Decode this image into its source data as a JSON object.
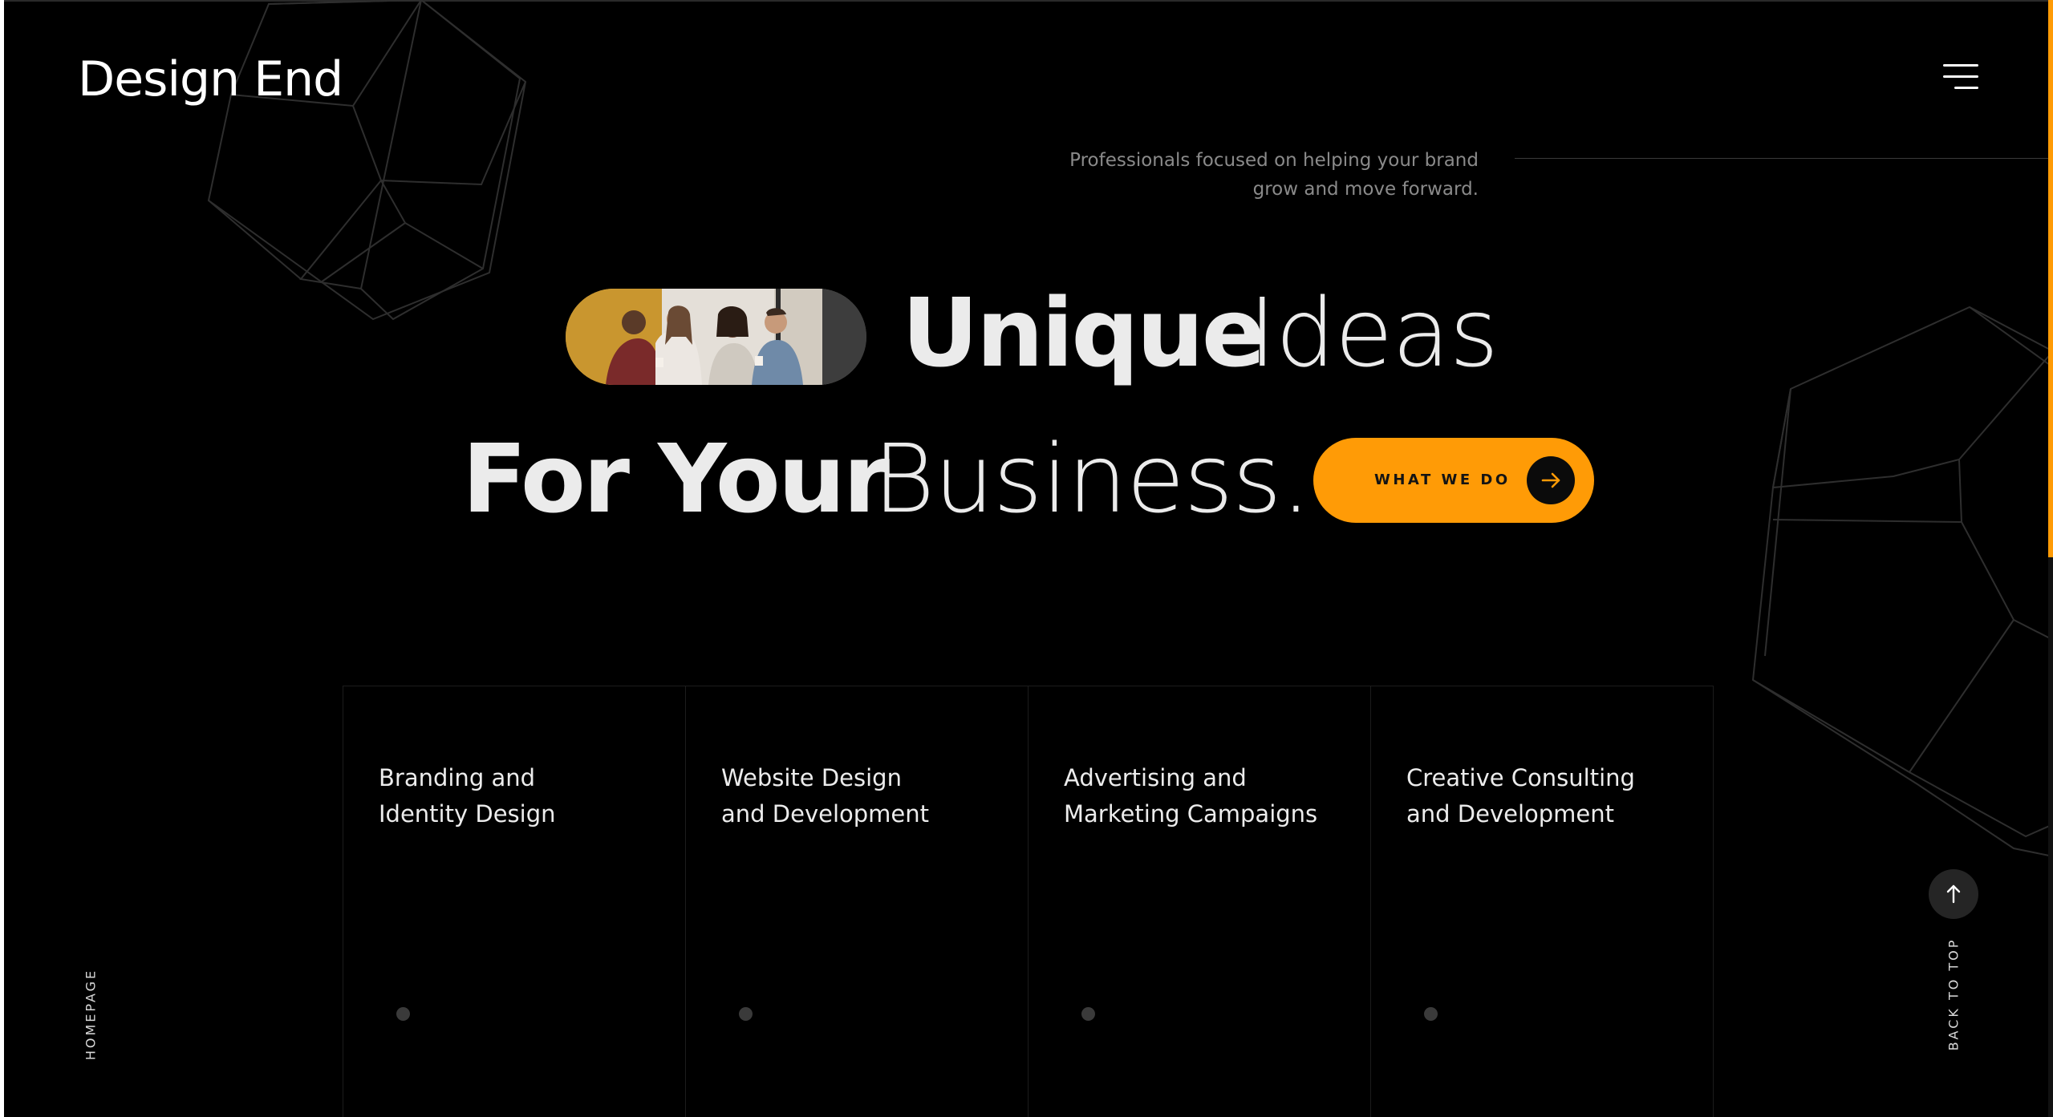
{
  "brand": {
    "logo_text": "Design End",
    "accent_color": "#ff9b06",
    "background_color": "#000000"
  },
  "header": {
    "menu_icon": "hamburger-menu-icon"
  },
  "hero": {
    "tagline_line1": "Professionals focused on helping your brand",
    "tagline_line2": "grow and move forward.",
    "line1_bold": "Unique",
    "line1_light": "Ideas",
    "line2_bold": "For Your",
    "line2_light": "Business.",
    "photo_alt": "team-photo",
    "cta_label": "WHAT WE DO",
    "cta_icon": "arrow-right-icon"
  },
  "services": [
    {
      "title_line1": "Branding and",
      "title_line2": "Identity Design"
    },
    {
      "title_line1": "Website Design",
      "title_line2": "and Development"
    },
    {
      "title_line1": "Advertising and",
      "title_line2": "Marketing Campaigns"
    },
    {
      "title_line1": "Creative Consulting",
      "title_line2": "and Development"
    }
  ],
  "side": {
    "page_label": "HOMEPAGE",
    "back_to_top_label": "BACK TO TOP",
    "back_to_top_icon": "arrow-up-icon"
  }
}
